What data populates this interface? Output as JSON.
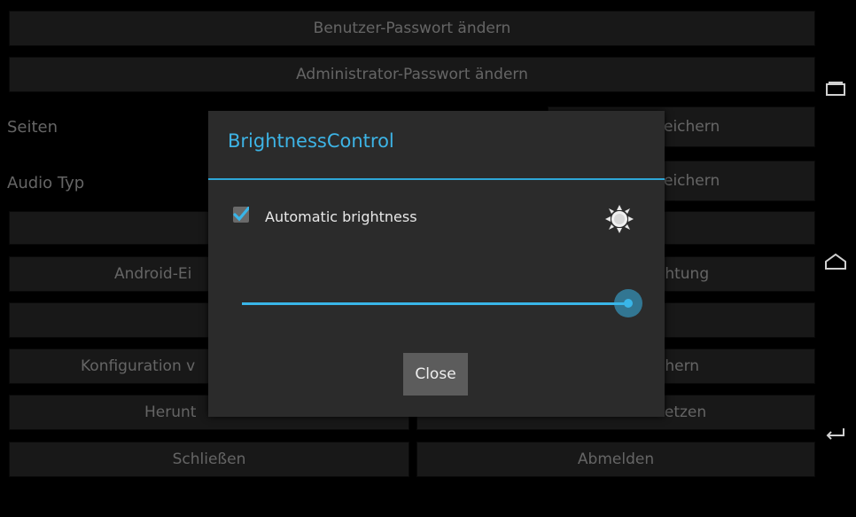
{
  "background": {
    "user_password_button": "Benutzer-Passwort ändern",
    "admin_password_button": "Administrator-Passwort ändern",
    "pages_label": "Seiten",
    "pages_save_partial": "eichern",
    "audio_label": "Audio Typ",
    "audio_save_partial": "eichern",
    "android_settings_partial": "Android-Ei",
    "orientation_partial": "chtung",
    "config_partial": "Konfiguration v",
    "config_save_partial": "chern",
    "shutdown_partial": "Herunt",
    "reset_partial": "setzen",
    "close_button": "Schließen",
    "logout_button": "Abmelden"
  },
  "dialog": {
    "title": "BrightnessControl",
    "checkbox_label": "Automatic brightness",
    "checkbox_checked": true,
    "brightness_level": 1.0,
    "close_button": "Close"
  },
  "nav": {
    "recent_icon": "recent-apps-icon",
    "home_icon": "home-icon",
    "back_icon": "back-icon"
  },
  "colors": {
    "accent": "#39b5e8",
    "dialog_bg": "#2b2b2b",
    "button_bg": "#2d2d2d"
  }
}
